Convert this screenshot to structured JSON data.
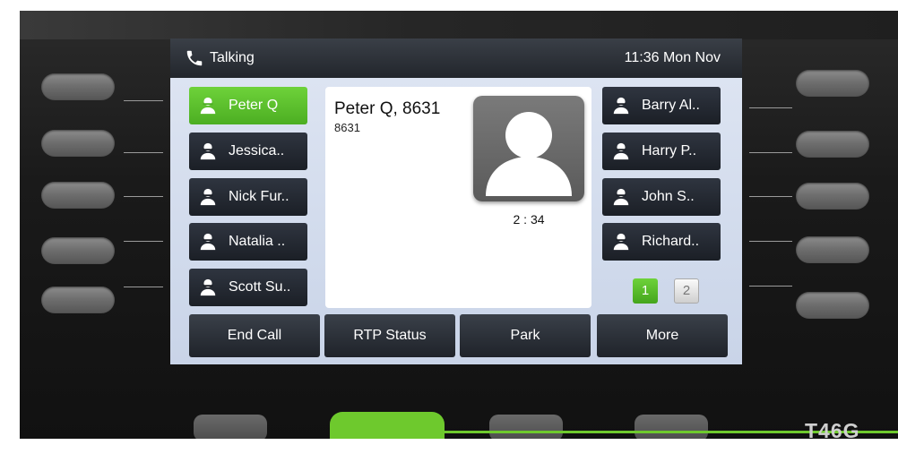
{
  "status_bar": {
    "status": "Talking",
    "clock": "11:36 Mon Nov"
  },
  "contacts_left": [
    {
      "label": "Peter Q",
      "active": true
    },
    {
      "label": "Jessica..",
      "active": false
    },
    {
      "label": "Nick Fur..",
      "active": false
    },
    {
      "label": "Natalia ..",
      "active": false
    },
    {
      "label": "Scott Su..",
      "active": false
    }
  ],
  "contacts_right": [
    {
      "label": "Barry Al.."
    },
    {
      "label": "Harry P.."
    },
    {
      "label": "John S.."
    },
    {
      "label": "Richard.."
    }
  ],
  "call": {
    "caller": "Peter Q, 8631",
    "number": "8631",
    "duration": "2 : 34"
  },
  "pages": {
    "current": "1",
    "other": "2"
  },
  "softkeys": [
    "End Call",
    "RTP Status",
    "Park",
    "More"
  ],
  "device": {
    "model": "T46G"
  },
  "colors": {
    "accent_green": "#6ec92d",
    "key_dark": "#22262c"
  },
  "icons": {
    "status": "phone-handset-icon",
    "contact": "person-icon",
    "avatar": "avatar-placeholder-icon"
  }
}
